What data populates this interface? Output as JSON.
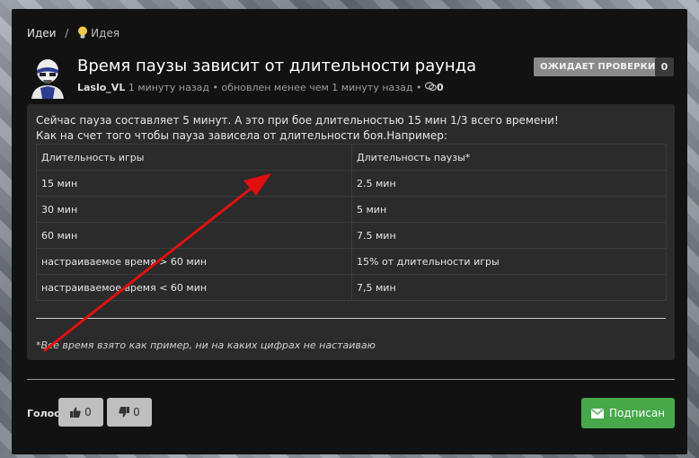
{
  "breadcrumb": {
    "root": "Идеи",
    "separator": "/",
    "current": "Идея"
  },
  "post": {
    "title": "Время паузы зависит от длительности раунда",
    "author": "Laslo_VL",
    "created": "1 минуту назад",
    "dot": "•",
    "updated": "обновлен менее чем 1 минуту назад",
    "comments_count": "0",
    "status_badge": "ОЖИДАЕТ ПРОВЕРКИ",
    "score": "0"
  },
  "content": {
    "line1": "Сейчас пауза составляет 5 минут. А это при бое длительностью 15 мин 1/3 всего времени!",
    "line2": "Как на счет того чтобы пауза зависела от длительности боя.Например:",
    "table": {
      "header": [
        "Длительность игры",
        "Длительность паузы*"
      ],
      "rows": [
        [
          "15 мин",
          "2.5 мин"
        ],
        [
          "30 мин",
          "5 мин"
        ],
        [
          "60 мин",
          "7.5 мин"
        ],
        [
          "настраиваемое время > 60 мин",
          "15% от длительности игры"
        ],
        [
          "настраиваемое время < 60 мин",
          "7,5 мин"
        ]
      ]
    },
    "note": "*Все время взято как пример, ни на каких цифрах не настаиваю"
  },
  "vote": {
    "label": "Голос",
    "up_count": "0",
    "down_count": "0"
  },
  "subscribe_label": "Подписан",
  "colors": {
    "panel": "#121212",
    "content_bg": "#2b2b2b",
    "subscribe": "#47a84a",
    "arrow": "#e01010"
  }
}
